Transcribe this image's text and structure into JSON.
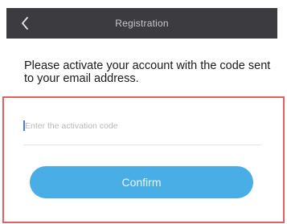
{
  "header": {
    "title": "Registration",
    "back_icon": "chevron-left-icon",
    "background_color": "#3b3b40"
  },
  "instructions": {
    "text": "Please activate your account with the code sent to your email address."
  },
  "form": {
    "code_input": {
      "placeholder": "Enter the activation code",
      "value": ""
    },
    "confirm_label": "Confirm",
    "confirm_color": "#4aaee6",
    "highlight_border_color": "#e46060"
  }
}
